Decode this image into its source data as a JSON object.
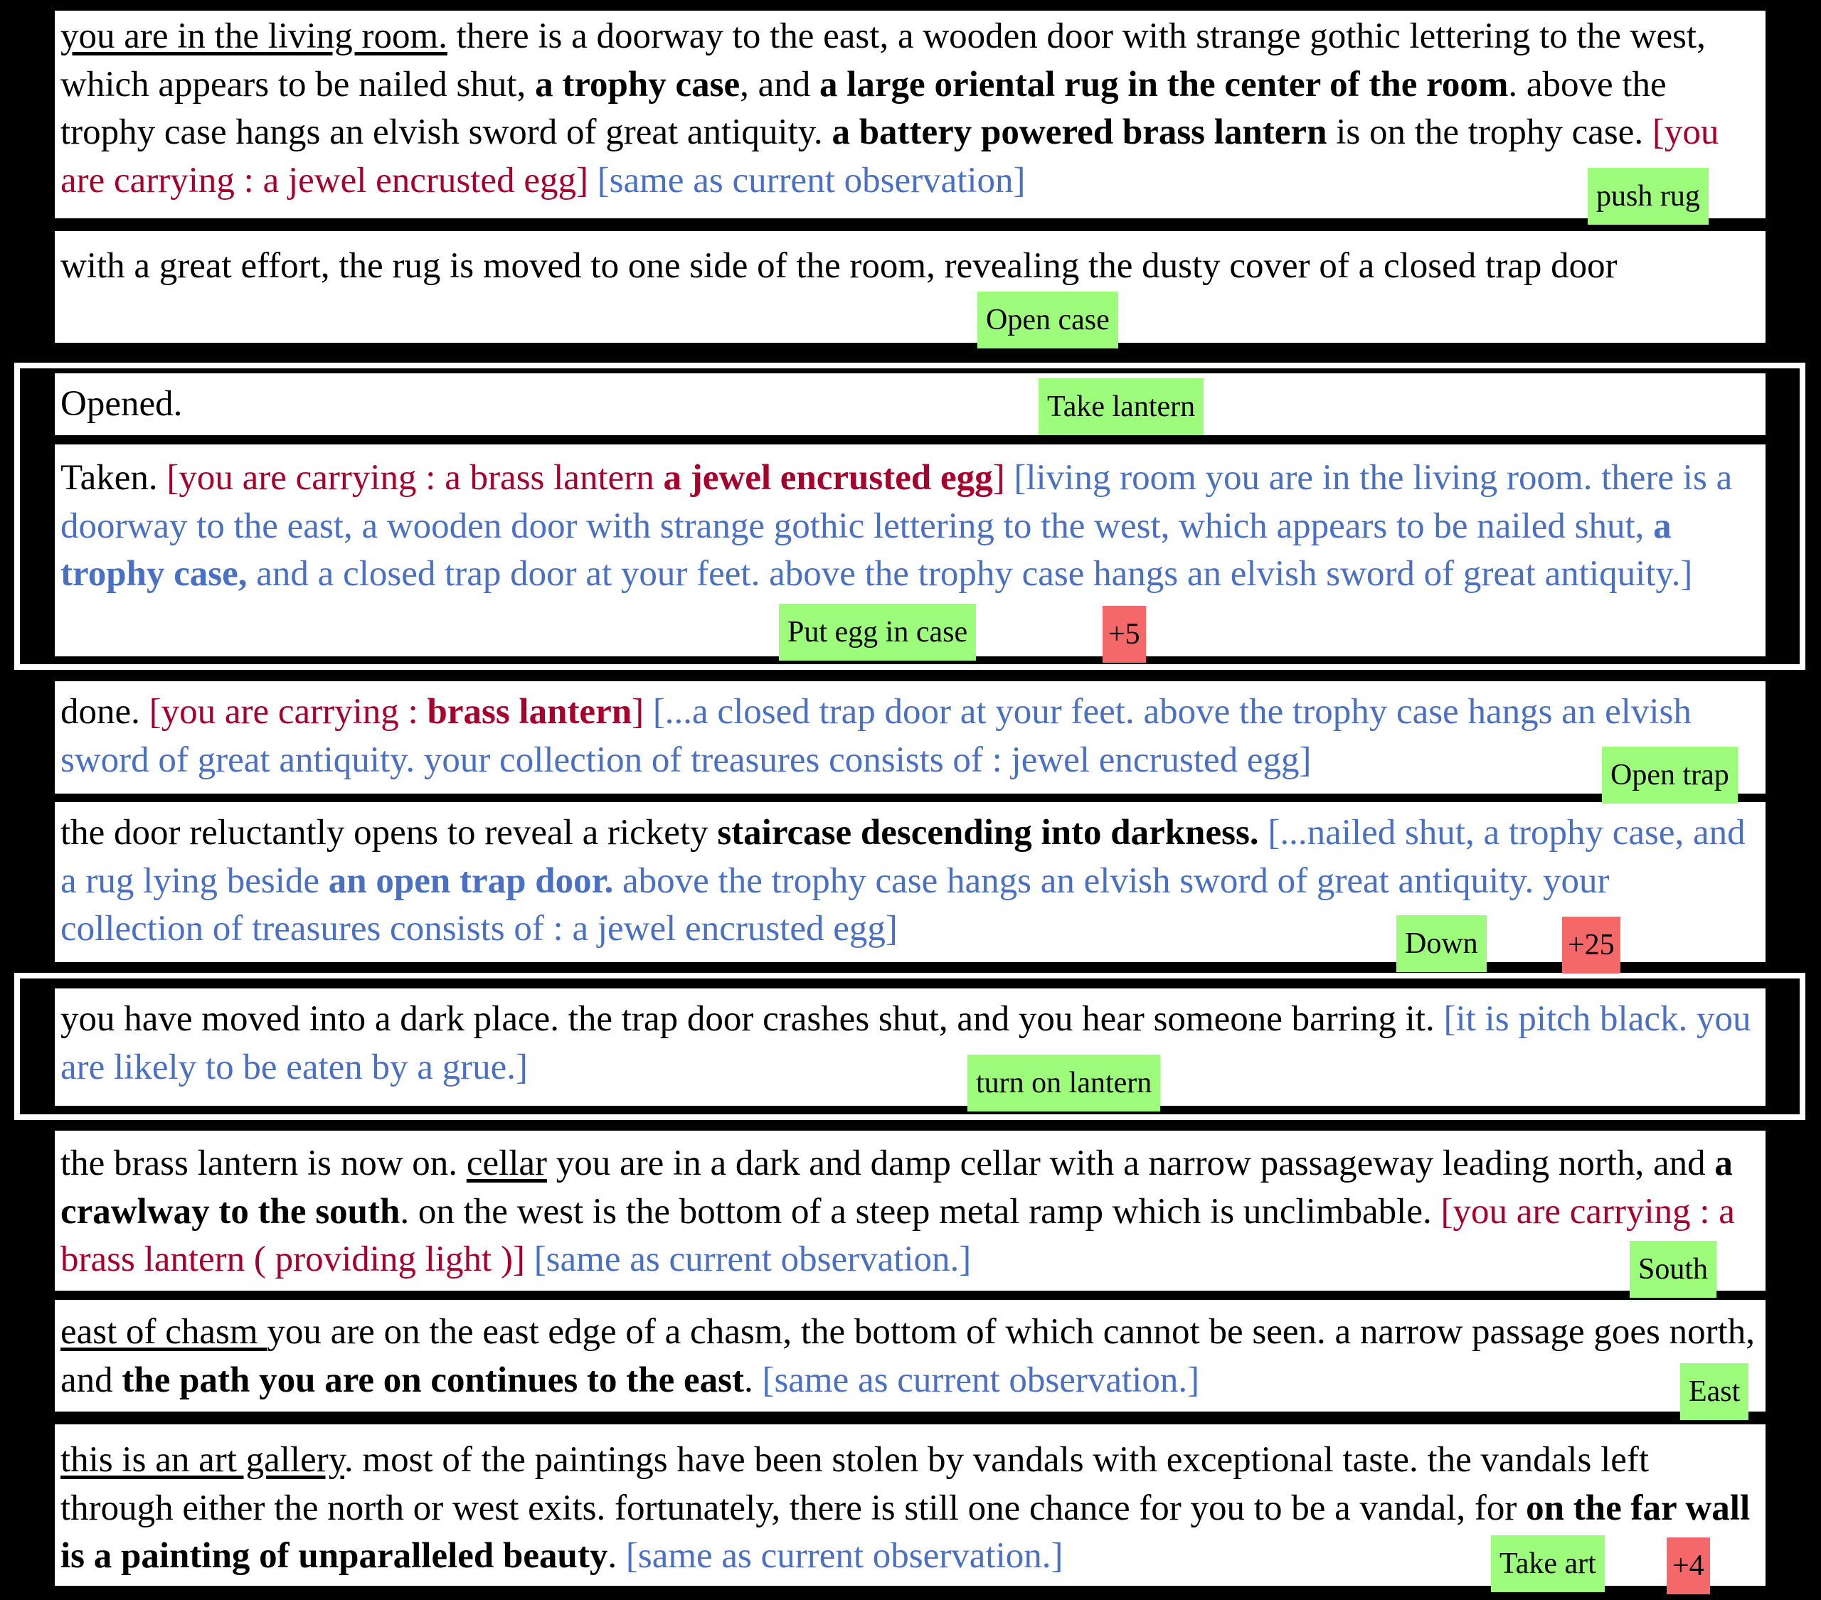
{
  "steps": [
    {
      "segments": [
        {
          "t": "you are in the living room.",
          "u": true
        },
        {
          "t": " there is a doorway to the east, a wooden door with strange gothic lettering to the west, which appears to be nailed shut, "
        },
        {
          "t": "a trophy case",
          "b": true
        },
        {
          "t": ", and "
        },
        {
          "t": "a large oriental rug in the center of the room",
          "b": true
        },
        {
          "t": ". above the trophy case hangs an elvish sword of great antiquity. "
        },
        {
          "t": "a battery powered brass lantern",
          "b": true
        },
        {
          "t": " is on the trophy case. "
        },
        {
          "t": "[you are carrying : a jewel encrusted egg]",
          "c": "red"
        },
        {
          "t": " "
        },
        {
          "t": "[same as current observation]",
          "c": "blue"
        }
      ],
      "action": "push rug"
    },
    {
      "segments": [
        {
          "t": "with a great effort, the rug is moved to one side of the room, revealing the dusty cover of a closed trap door"
        }
      ],
      "action": "Open case"
    },
    {
      "segments": [
        {
          "t": "Opened."
        }
      ],
      "action": "Take lantern"
    },
    {
      "segments": [
        {
          "t": "Taken. "
        },
        {
          "t": "[you are carrying : a brass lantern ",
          "c": "red"
        },
        {
          "t": "a jewel encrusted egg",
          "c": "red",
          "b": true
        },
        {
          "t": "]",
          "c": "red"
        },
        {
          "t": " "
        },
        {
          "t": "[living room you are in the living room. there is a doorway to the east, a wooden door with strange gothic lettering to the west, which appears to be nailed shut, ",
          "c": "blue"
        },
        {
          "t": "a trophy case,",
          "c": "blue",
          "b": true
        },
        {
          "t": " and a closed trap door at your feet. above the trophy case hangs an elvish sword of great antiquity.]",
          "c": "blue"
        }
      ],
      "action": "Put egg in case",
      "score": "+5"
    },
    {
      "segments": [
        {
          "t": "done. "
        },
        {
          "t": "[you are carrying : ",
          "c": "red"
        },
        {
          "t": "brass lantern",
          "c": "red",
          "b": true
        },
        {
          "t": "]",
          "c": "red"
        },
        {
          "t": " "
        },
        {
          "t": "[...a closed trap door at your feet. above the trophy case hangs an elvish sword of great antiquity. your collection of treasures consists of : jewel encrusted egg]",
          "c": "blue"
        }
      ],
      "action": "Open trap"
    },
    {
      "segments": [
        {
          "t": "the door reluctantly opens to reveal a rickety "
        },
        {
          "t": "staircase descending into darkness.",
          "b": true
        },
        {
          "t": " "
        },
        {
          "t": "[...nailed shut, a trophy case, and a rug lying beside ",
          "c": "blue"
        },
        {
          "t": "an open trap door.",
          "c": "blue",
          "b": true
        },
        {
          "t": " above the trophy case hangs an elvish sword of great antiquity. your collection of treasures consists of : a jewel encrusted egg]",
          "c": "blue"
        }
      ],
      "action": "Down",
      "score": "+25"
    },
    {
      "segments": [
        {
          "t": "you have moved into a dark place. the trap door crashes shut, and you hear someone barring it. "
        },
        {
          "t": "[it is pitch black. you are likely to be eaten by a grue.]",
          "c": "blue"
        }
      ],
      "action": "turn  on lantern"
    },
    {
      "segments": [
        {
          "t": "the brass lantern is now on. "
        },
        {
          "t": "cellar",
          "u": true
        },
        {
          "t": " you are in a dark and damp cellar with a narrow passageway leading north, and "
        },
        {
          "t": "a crawlway to the south",
          "b": true
        },
        {
          "t": ". on the west is the bottom of a steep metal ramp which is unclimbable. "
        },
        {
          "t": "[you are carrying : a brass lantern ( providing light )]",
          "c": "red"
        },
        {
          "t": " "
        },
        {
          "t": "[same as current observation.]",
          "c": "blue"
        }
      ],
      "action": "South"
    },
    {
      "segments": [
        {
          "t": "east of chasm ",
          "u": true
        },
        {
          "t": "you are on the east edge of a chasm, the bottom of which cannot be seen. a narrow passage goes north, and "
        },
        {
          "t": "the path you are on continues to the east",
          "b": true
        },
        {
          "t": ". "
        },
        {
          "t": "[same as current observation.]",
          "c": "blue"
        }
      ],
      "action": "East"
    },
    {
      "segments": [
        {
          "t": "this is an art gallery",
          "u": true
        },
        {
          "t": ". most of the paintings have been stolen by vandals with exceptional taste. the vandals left through either the north or west exits. fortunately, there is still one chance for you to be a vandal, for "
        },
        {
          "t": "on the far wall is a painting of unparalleled beauty",
          "b": true
        },
        {
          "t": ". "
        },
        {
          "t": "[same as current observation.]",
          "c": "blue"
        }
      ],
      "action": "Take art",
      "score": "+4"
    }
  ],
  "colors": {
    "red": "#a8002d",
    "blue": "#4a70c4",
    "action_bg": "#9efc7c",
    "score_bg": "#f4686a"
  }
}
